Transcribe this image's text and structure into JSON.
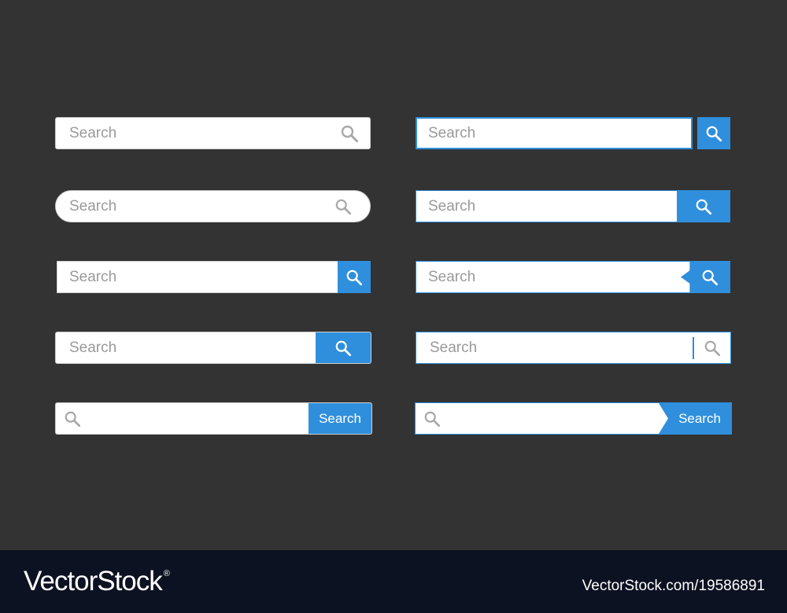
{
  "search": {
    "placeholder": "Search",
    "button_label": "Search"
  },
  "colors": {
    "background": "#333333",
    "accent": "#2f8fdc",
    "footer": "#0d1222"
  },
  "icons": {
    "search": "magnifier-icon"
  },
  "footer": {
    "brand": "VectorStock",
    "registered": "®",
    "stock_id": "VectorStock.com/19586891"
  }
}
